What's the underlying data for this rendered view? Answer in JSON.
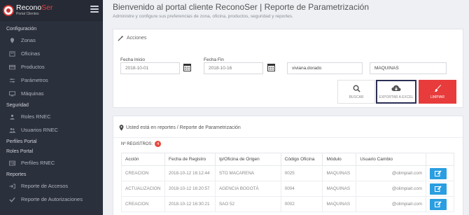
{
  "brand": {
    "name_part1": "Recono",
    "name_part2": "Ser",
    "subtitle": "Portal Clientes"
  },
  "sidebar": {
    "sections": [
      {
        "title": "Configuración",
        "items": [
          {
            "label": "Zonas",
            "icon": "map-marker-icon"
          },
          {
            "label": "Oficinas",
            "icon": "building-icon"
          },
          {
            "label": "Productos",
            "icon": "card-icon"
          },
          {
            "label": "Parámetros",
            "icon": "sliders-icon"
          },
          {
            "label": "Máquinas",
            "icon": "monitor-icon"
          }
        ]
      },
      {
        "title": "Seguridad",
        "items": [
          {
            "label": "Roles RNEC",
            "icon": "user-icon"
          },
          {
            "label": "Usuarios RNEC",
            "icon": "users-icon"
          }
        ]
      },
      {
        "title": "Perfiles Portal",
        "items": []
      },
      {
        "title": "Roles Portal",
        "items": [
          {
            "label": "Perfiles RNEC",
            "icon": "id-card-icon"
          }
        ]
      },
      {
        "title": "Reportes",
        "items": [
          {
            "label": "Reporte de Accesos",
            "icon": "sign-in-icon"
          },
          {
            "label": "Reporte de Autorizaciones",
            "icon": "check-icon"
          }
        ]
      }
    ]
  },
  "header": {
    "title": "Bienvenido al portal cliente ReconoSer | Reporte de Parametrización",
    "subtitle": "Administre y configure sus preferencias de zona, oficina, productos, seguridad y reportes."
  },
  "acciones": {
    "title": "Acciones",
    "fecha_inicio": {
      "label": "Fecha Inicio",
      "value": "2018-10-01"
    },
    "fecha_fin": {
      "label": "Fecha Fin",
      "value": "2018-10-16"
    },
    "usuario": {
      "value": "viviana.dorado"
    },
    "modulo": {
      "value": "MAQUINAS"
    },
    "buttons": {
      "buscar": "BUSCAR",
      "exportar": "EXPORTAR A EXCEL",
      "limpiar": "LIMPIAR"
    }
  },
  "report": {
    "breadcrumb": "Usted está en reportes / Reporte de Parametrización",
    "count_label": "Nº REGISTROS:",
    "count": "4",
    "columns": [
      "Acción",
      "Fecha de Registro",
      "Ip/Oficina de Origen",
      "Código Oficina",
      "Módulo",
      "Usuario Cambio",
      ""
    ],
    "rows": [
      [
        "CREACION",
        "2018-10-12 16:12:44",
        "STO MACARENA",
        "0025",
        "MAQUINAS",
        "@olimpiait.com"
      ],
      [
        "ACTUALIZACION",
        "2018-10-12 16:20:57",
        "AGENCIA BOGOTÁ",
        "0004",
        "MAQUINAS",
        "@olimpiait.com"
      ],
      [
        "CREACION",
        "2018-10-12 16:30:21",
        "SAO 52",
        "0002",
        "MAQUINAS",
        "@olimpiait.com"
      ]
    ]
  },
  "colors": {
    "sidebar": "#2b303d",
    "accent_red": "#e83c3c",
    "edit_blue": "#2a9ee0"
  }
}
